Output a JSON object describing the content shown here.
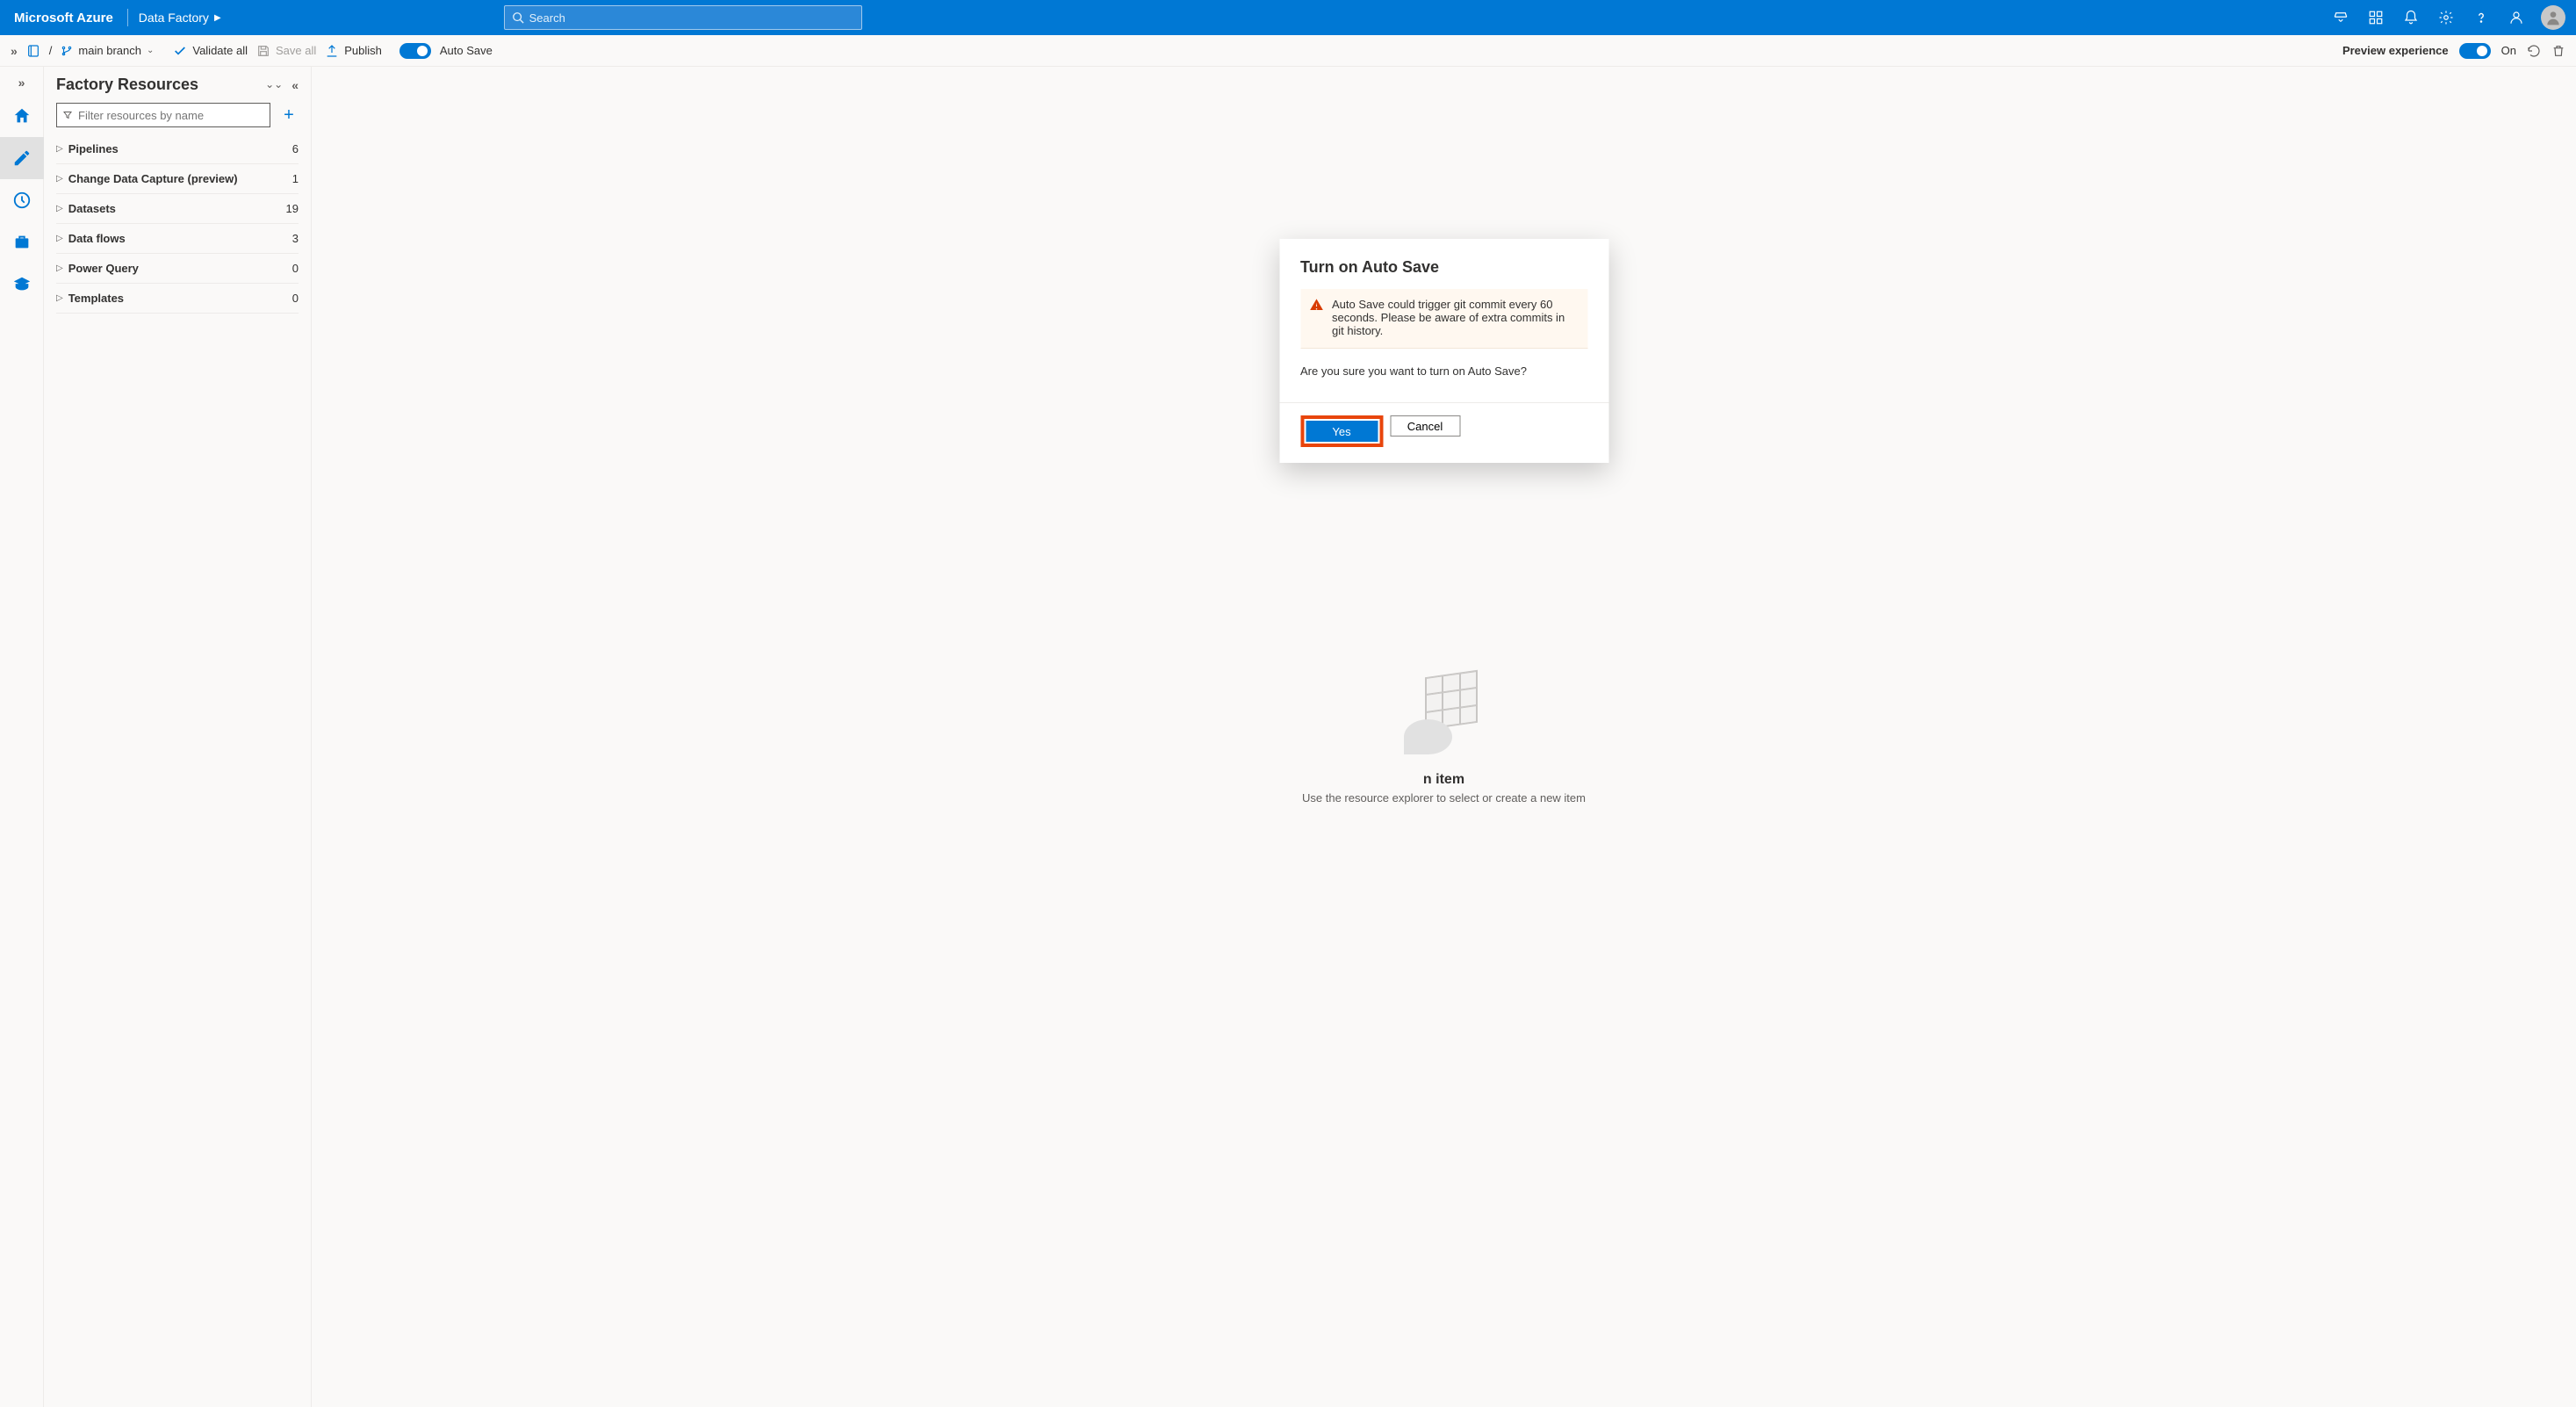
{
  "header": {
    "brand": "Microsoft Azure",
    "breadcrumb": "Data Factory",
    "search_placeholder": "Search"
  },
  "toolbar": {
    "branch": "main branch",
    "validate": "Validate all",
    "save_all": "Save all",
    "publish": "Publish",
    "auto_save": "Auto Save",
    "preview": "Preview experience",
    "preview_state": "On"
  },
  "resource_panel": {
    "title": "Factory Resources",
    "filter_placeholder": "Filter resources by name",
    "items": [
      {
        "name": "Pipelines",
        "count": "6"
      },
      {
        "name": "Change Data Capture (preview)",
        "count": "1"
      },
      {
        "name": "Datasets",
        "count": "19"
      },
      {
        "name": "Data flows",
        "count": "3"
      },
      {
        "name": "Power Query",
        "count": "0"
      },
      {
        "name": "Templates",
        "count": "0"
      }
    ]
  },
  "empty": {
    "title_suffix": "n item",
    "subtitle": "Use the resource explorer to select or create a new item"
  },
  "modal": {
    "title": "Turn on Auto Save",
    "warning": "Auto Save could trigger git commit every 60 seconds. Please be aware of extra commits in git history.",
    "question": "Are you sure you want to turn on Auto Save?",
    "yes": "Yes",
    "cancel": "Cancel"
  }
}
